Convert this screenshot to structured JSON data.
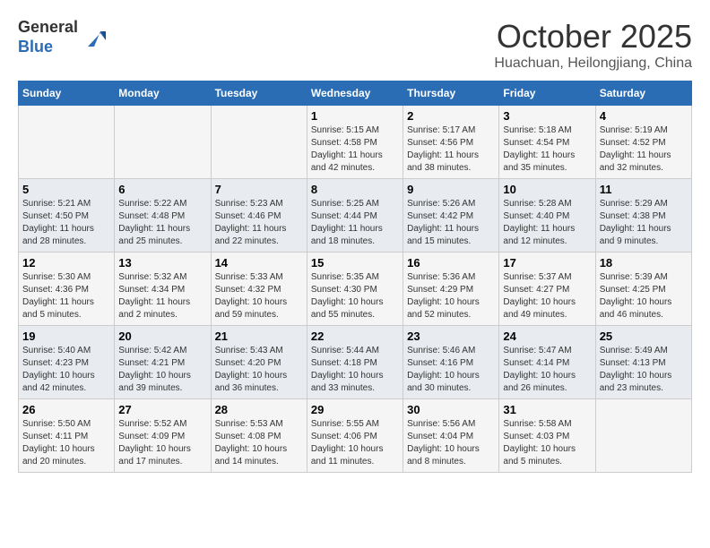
{
  "header": {
    "logo_line1": "General",
    "logo_line2": "Blue",
    "month": "October 2025",
    "location": "Huachuan, Heilongjiang, China"
  },
  "weekdays": [
    "Sunday",
    "Monday",
    "Tuesday",
    "Wednesday",
    "Thursday",
    "Friday",
    "Saturday"
  ],
  "weeks": [
    [
      {
        "day": "",
        "info": ""
      },
      {
        "day": "",
        "info": ""
      },
      {
        "day": "",
        "info": ""
      },
      {
        "day": "1",
        "info": "Sunrise: 5:15 AM\nSunset: 4:58 PM\nDaylight: 11 hours\nand 42 minutes."
      },
      {
        "day": "2",
        "info": "Sunrise: 5:17 AM\nSunset: 4:56 PM\nDaylight: 11 hours\nand 38 minutes."
      },
      {
        "day": "3",
        "info": "Sunrise: 5:18 AM\nSunset: 4:54 PM\nDaylight: 11 hours\nand 35 minutes."
      },
      {
        "day": "4",
        "info": "Sunrise: 5:19 AM\nSunset: 4:52 PM\nDaylight: 11 hours\nand 32 minutes."
      }
    ],
    [
      {
        "day": "5",
        "info": "Sunrise: 5:21 AM\nSunset: 4:50 PM\nDaylight: 11 hours\nand 28 minutes."
      },
      {
        "day": "6",
        "info": "Sunrise: 5:22 AM\nSunset: 4:48 PM\nDaylight: 11 hours\nand 25 minutes."
      },
      {
        "day": "7",
        "info": "Sunrise: 5:23 AM\nSunset: 4:46 PM\nDaylight: 11 hours\nand 22 minutes."
      },
      {
        "day": "8",
        "info": "Sunrise: 5:25 AM\nSunset: 4:44 PM\nDaylight: 11 hours\nand 18 minutes."
      },
      {
        "day": "9",
        "info": "Sunrise: 5:26 AM\nSunset: 4:42 PM\nDaylight: 11 hours\nand 15 minutes."
      },
      {
        "day": "10",
        "info": "Sunrise: 5:28 AM\nSunset: 4:40 PM\nDaylight: 11 hours\nand 12 minutes."
      },
      {
        "day": "11",
        "info": "Sunrise: 5:29 AM\nSunset: 4:38 PM\nDaylight: 11 hours\nand 9 minutes."
      }
    ],
    [
      {
        "day": "12",
        "info": "Sunrise: 5:30 AM\nSunset: 4:36 PM\nDaylight: 11 hours\nand 5 minutes."
      },
      {
        "day": "13",
        "info": "Sunrise: 5:32 AM\nSunset: 4:34 PM\nDaylight: 11 hours\nand 2 minutes."
      },
      {
        "day": "14",
        "info": "Sunrise: 5:33 AM\nSunset: 4:32 PM\nDaylight: 10 hours\nand 59 minutes."
      },
      {
        "day": "15",
        "info": "Sunrise: 5:35 AM\nSunset: 4:30 PM\nDaylight: 10 hours\nand 55 minutes."
      },
      {
        "day": "16",
        "info": "Sunrise: 5:36 AM\nSunset: 4:29 PM\nDaylight: 10 hours\nand 52 minutes."
      },
      {
        "day": "17",
        "info": "Sunrise: 5:37 AM\nSunset: 4:27 PM\nDaylight: 10 hours\nand 49 minutes."
      },
      {
        "day": "18",
        "info": "Sunrise: 5:39 AM\nSunset: 4:25 PM\nDaylight: 10 hours\nand 46 minutes."
      }
    ],
    [
      {
        "day": "19",
        "info": "Sunrise: 5:40 AM\nSunset: 4:23 PM\nDaylight: 10 hours\nand 42 minutes."
      },
      {
        "day": "20",
        "info": "Sunrise: 5:42 AM\nSunset: 4:21 PM\nDaylight: 10 hours\nand 39 minutes."
      },
      {
        "day": "21",
        "info": "Sunrise: 5:43 AM\nSunset: 4:20 PM\nDaylight: 10 hours\nand 36 minutes."
      },
      {
        "day": "22",
        "info": "Sunrise: 5:44 AM\nSunset: 4:18 PM\nDaylight: 10 hours\nand 33 minutes."
      },
      {
        "day": "23",
        "info": "Sunrise: 5:46 AM\nSunset: 4:16 PM\nDaylight: 10 hours\nand 30 minutes."
      },
      {
        "day": "24",
        "info": "Sunrise: 5:47 AM\nSunset: 4:14 PM\nDaylight: 10 hours\nand 26 minutes."
      },
      {
        "day": "25",
        "info": "Sunrise: 5:49 AM\nSunset: 4:13 PM\nDaylight: 10 hours\nand 23 minutes."
      }
    ],
    [
      {
        "day": "26",
        "info": "Sunrise: 5:50 AM\nSunset: 4:11 PM\nDaylight: 10 hours\nand 20 minutes."
      },
      {
        "day": "27",
        "info": "Sunrise: 5:52 AM\nSunset: 4:09 PM\nDaylight: 10 hours\nand 17 minutes."
      },
      {
        "day": "28",
        "info": "Sunrise: 5:53 AM\nSunset: 4:08 PM\nDaylight: 10 hours\nand 14 minutes."
      },
      {
        "day": "29",
        "info": "Sunrise: 5:55 AM\nSunset: 4:06 PM\nDaylight: 10 hours\nand 11 minutes."
      },
      {
        "day": "30",
        "info": "Sunrise: 5:56 AM\nSunset: 4:04 PM\nDaylight: 10 hours\nand 8 minutes."
      },
      {
        "day": "31",
        "info": "Sunrise: 5:58 AM\nSunset: 4:03 PM\nDaylight: 10 hours\nand 5 minutes."
      },
      {
        "day": "",
        "info": ""
      }
    ]
  ]
}
